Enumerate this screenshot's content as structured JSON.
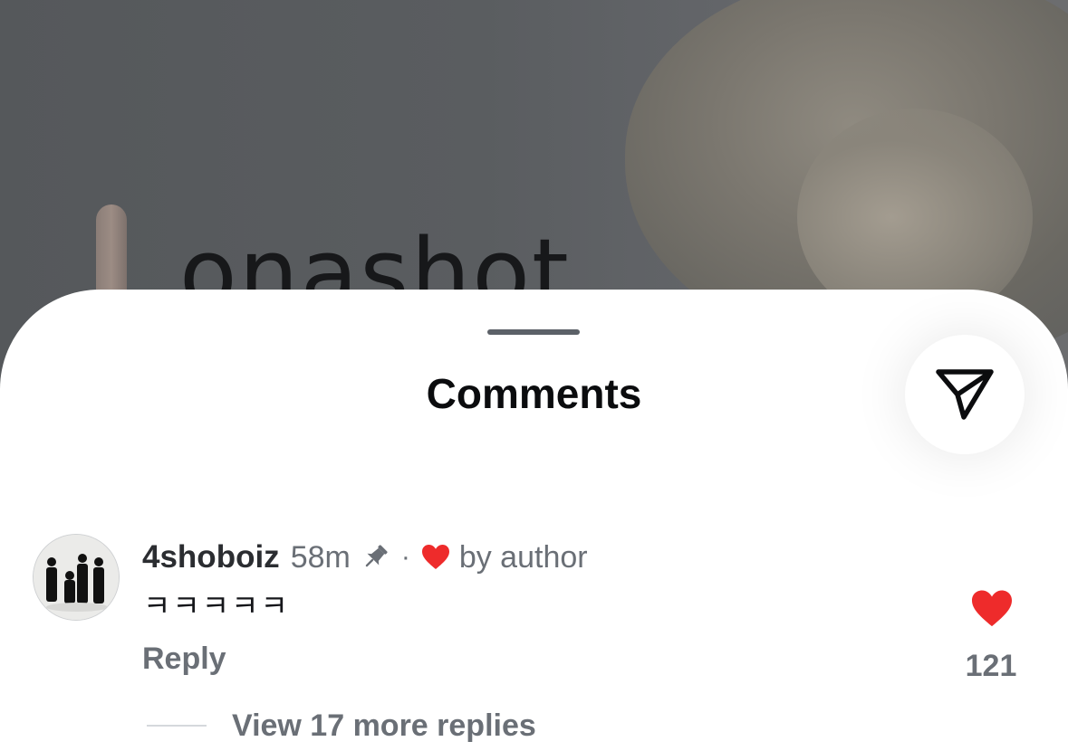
{
  "background": {
    "overlay_text": "onashot"
  },
  "sheet": {
    "title": "Comments",
    "share_icon": "send-icon"
  },
  "comment": {
    "username": "4shoboiz",
    "time": "58m",
    "separator": "·",
    "author_badge": "by author",
    "text": "ㅋㅋㅋㅋㅋ",
    "reply_label": "Reply",
    "like_count": "121",
    "view_replies": "View 17 more replies",
    "icons": {
      "pin": "pin-icon",
      "author_heart": "heart-icon",
      "like": "heart-icon"
    }
  },
  "colors": {
    "heart": "#ee2b2b",
    "secondary_text": "#6a6f76",
    "primary_text": "#2b2d31",
    "title": "#0b0c0e"
  }
}
